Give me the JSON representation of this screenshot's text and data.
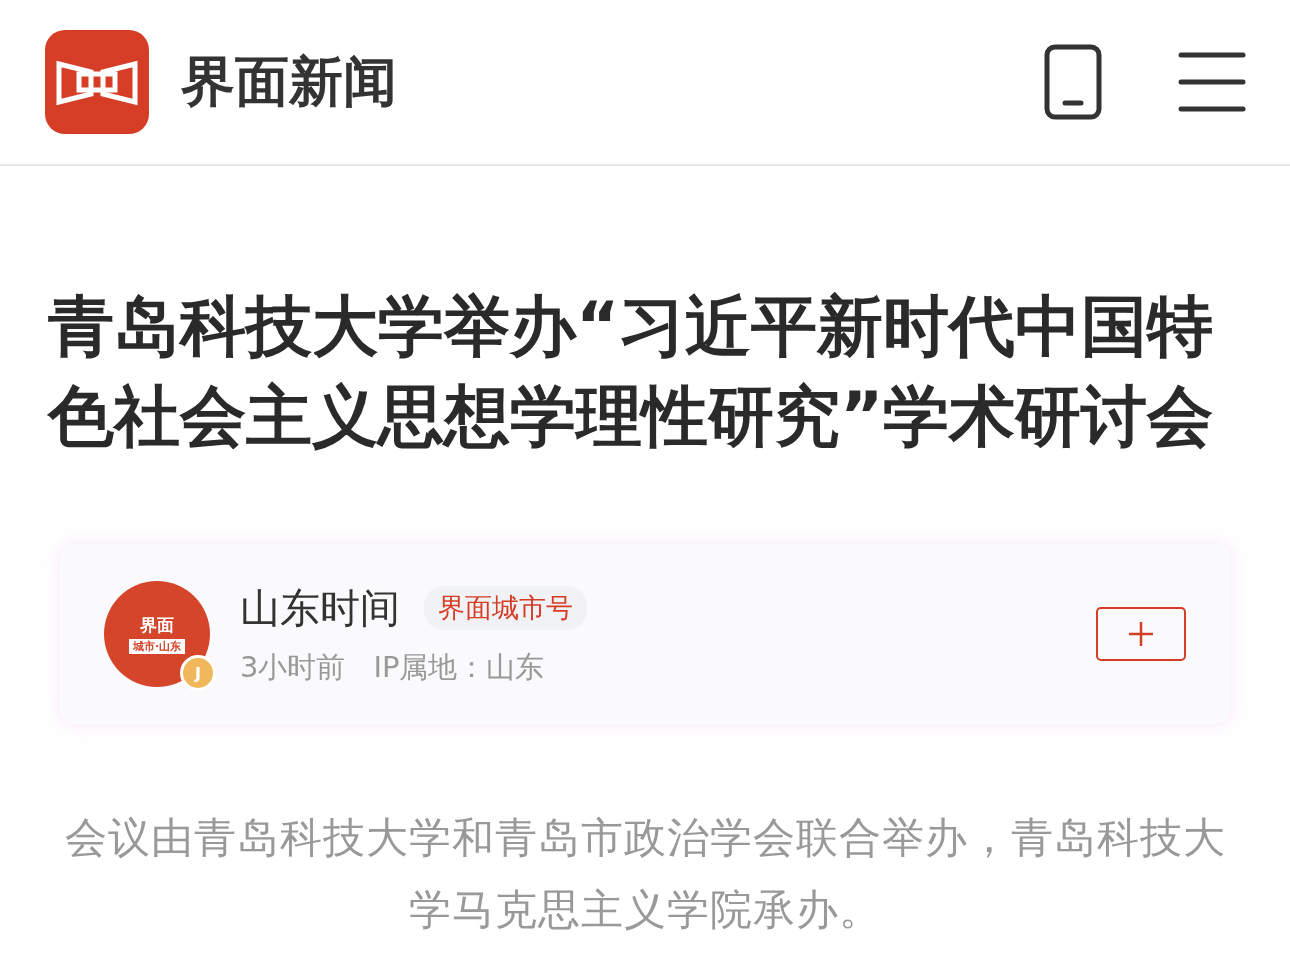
{
  "header": {
    "site_name": "界面新闻"
  },
  "article": {
    "title": "青岛科技大学举办“习近平新时代中国特色社会主义思想学理性研究”学术研讨会",
    "author": {
      "avatar_line1": "界面",
      "avatar_line2": "城市·山东",
      "badge": "J",
      "name": "山东时间",
      "tag": "界面城市号",
      "time": "3小时前",
      "location": "IP属地：山东",
      "followed": false
    },
    "summary": "会议由青岛科技大学和青岛市政治学会联合举办，青岛科技大学马克思主义学院承办。"
  }
}
